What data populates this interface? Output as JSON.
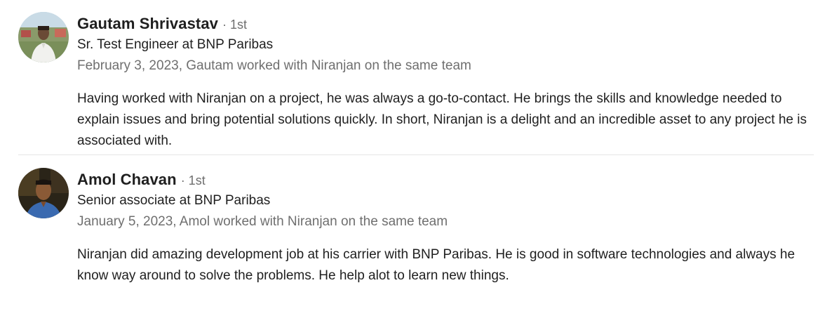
{
  "recommendations": [
    {
      "name": "Gautam Shrivastav",
      "degree": "· 1st",
      "headline": "Sr. Test Engineer at BNP Paribas",
      "meta": "February 3, 2023, Gautam worked with Niranjan on the same team",
      "text": "Having worked with Niranjan on a project, he was always a go-to-contact. He brings the skills and knowledge needed to explain issues and bring potential solutions quickly. In short, Niranjan is a delight and an incredible asset to any project he is associated with."
    },
    {
      "name": "Amol Chavan",
      "degree": "· 1st",
      "headline": "Senior associate at BNP Paribas",
      "meta": "January 5, 2023, Amol worked with Niranjan on the same team",
      "text": "Niranjan did amazing development job at his carrier with BNP Paribas. He is good in software technologies and always he know way around to solve the problems. He help alot to learn new things."
    }
  ]
}
